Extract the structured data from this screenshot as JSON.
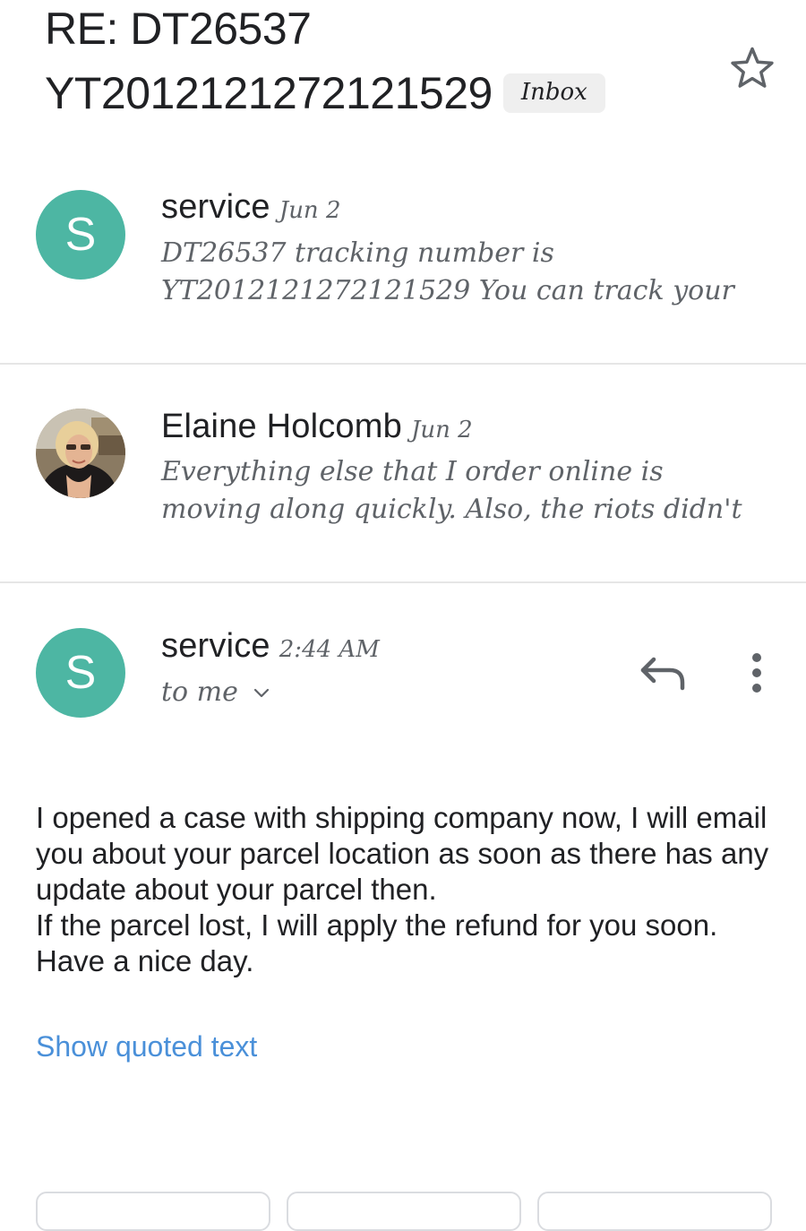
{
  "subject": {
    "line1": "RE: DT26537",
    "line2": "YT201212127212152​9",
    "label": "Inbox"
  },
  "messages": [
    {
      "sender": "service",
      "date": "Jun 2",
      "avatar_letter": "S",
      "snippet": "DT26537 tracking number is YT201212127212152​9 You can track your"
    },
    {
      "sender": "Elaine Holcomb",
      "date": "Jun 2",
      "snippet": "Everything else that I order online is moving along quickly. Also, the riots didn't"
    },
    {
      "sender": "service",
      "date": "2:44 AM",
      "avatar_letter": "S",
      "recipient": "to me",
      "body": [
        "I opened a case with shipping company now, I will email you about your parcel location as soon as there has any update about your parcel then.",
        "If the parcel lost, I will apply the refund for you soon.",
        "Have a nice day."
      ],
      "show_quoted": "Show quoted text"
    }
  ],
  "icons": {
    "star": "star-icon",
    "reply": "reply-icon",
    "more": "more-vert-icon",
    "expand": "chevron-down-icon"
  },
  "colors": {
    "avatar": "#4db6a3",
    "link": "#4a90d9",
    "badge_bg": "#efefef"
  }
}
